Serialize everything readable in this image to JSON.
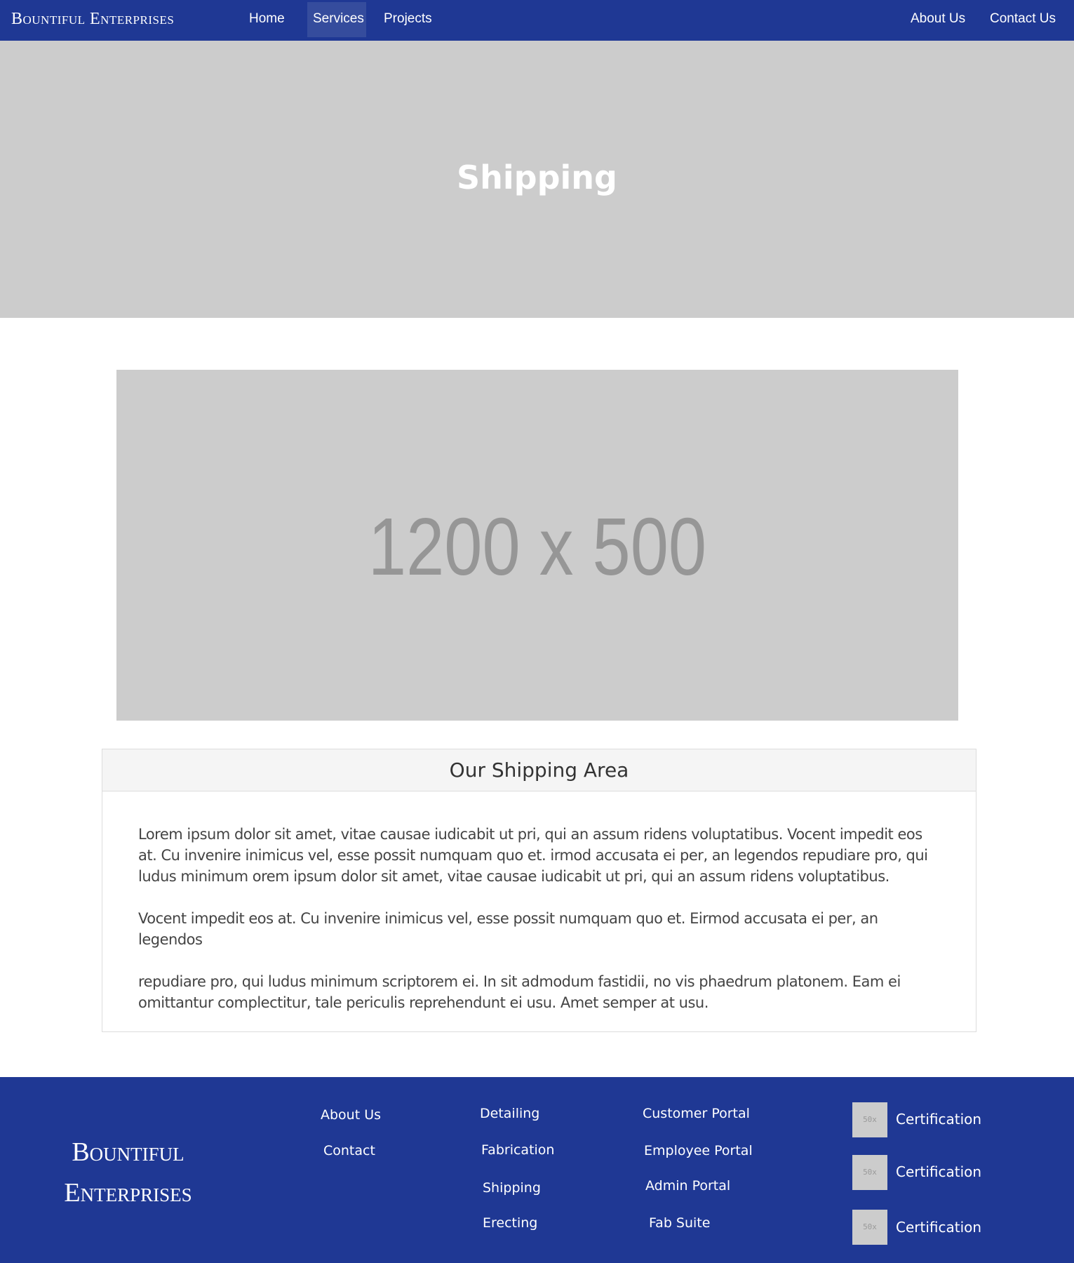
{
  "navbar": {
    "brand": "Bountiful Enterprises",
    "links": [
      {
        "label": "Home"
      },
      {
        "label": "Services",
        "active": true
      },
      {
        "label": "Projects"
      }
    ],
    "right_links": [
      {
        "label": "About Us"
      },
      {
        "label": "Contact Us"
      }
    ]
  },
  "hero": {
    "title": "Shipping"
  },
  "main_image": {
    "placeholder_text": "1200 x 500"
  },
  "panel": {
    "heading": "Our Shipping Area",
    "paragraphs": [
      "Lorem ipsum dolor sit amet, vitae causae iudicabit ut pri, qui an assum ridens voluptatibus. Vocent impedit eos at. Cu invenire inimicus vel, esse possit numquam quo et.  irmod accusata ei per, an legendos repudiare pro, qui ludus minimum orem ipsum dolor sit amet, vitae causae iudicabit ut pri, qui an assum ridens voluptatibus.",
      "Vocent impedit eos at. Cu invenire inimicus vel, esse possit numquam quo et. Eirmod accusata ei per, an legendos",
      "repudiare pro, qui ludus minimum scriptorem ei. In sit admodum fastidii, no vis phaedrum platonem. Eam ei omittantur complectitur, tale periculis reprehendunt ei usu. Amet semper at usu."
    ]
  },
  "footer": {
    "brand_line1": "Bountiful",
    "brand_line2": "Enterprises",
    "col1": [
      "About Us",
      "Contact"
    ],
    "col2": [
      "Detailing",
      "Fabrication",
      "Shipping",
      "Erecting"
    ],
    "col3": [
      "Customer Portal",
      "Employee Portal",
      "Admin Portal",
      "Fab Suite"
    ],
    "certifications": [
      {
        "thumb": "50x",
        "label": "Certification"
      },
      {
        "thumb": "50x",
        "label": "Certification"
      },
      {
        "thumb": "50x",
        "label": "Certification"
      }
    ]
  },
  "colors": {
    "primary": "#1f3894",
    "active_nav": "#354c9d",
    "placeholder": "#cccccc"
  }
}
